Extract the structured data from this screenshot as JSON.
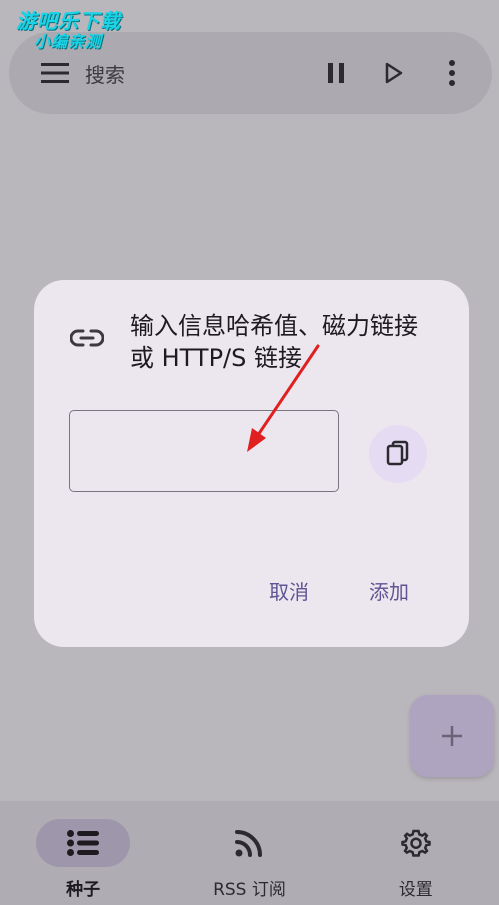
{
  "watermark": {
    "line1": "游吧乐下载",
    "line2": "小编亲测"
  },
  "search_bar": {
    "placeholder": "搜索"
  },
  "dialog": {
    "title": "输入信息哈希值、磁力链接或 HTTP/S 链接",
    "input_value": "",
    "cancel_label": "取消",
    "add_label": "添加"
  },
  "fab": {
    "label": "+"
  },
  "bottom_nav": {
    "items": [
      {
        "label": "种子",
        "icon": "list-icon",
        "active": true
      },
      {
        "label": "RSS 订阅",
        "icon": "rss-icon",
        "active": false
      },
      {
        "label": "设置",
        "icon": "gear-icon",
        "active": false
      }
    ]
  },
  "colors": {
    "accent": "#5f5494",
    "dialog_bg": "#ece6ef",
    "annotation_arrow": "#e02020"
  }
}
